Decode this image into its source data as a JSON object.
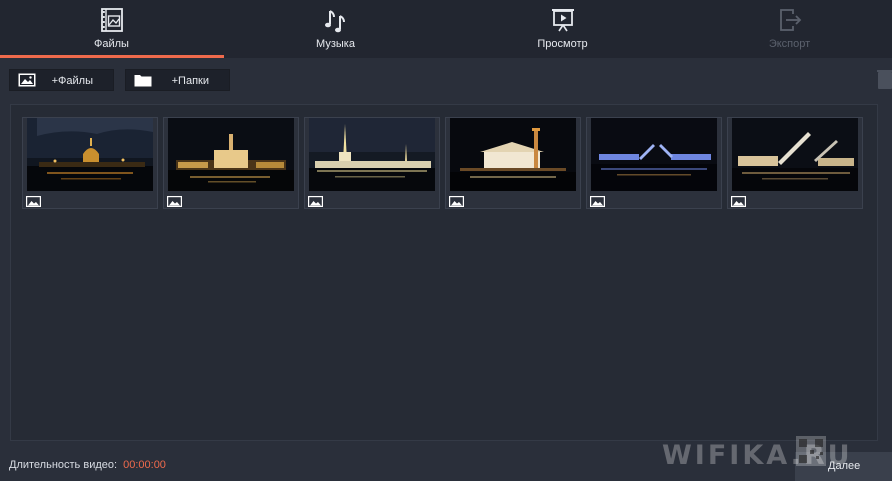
{
  "tabs": [
    {
      "label": "Файлы",
      "icon": "film-image-icon",
      "active": true
    },
    {
      "label": "Музыка",
      "icon": "music-notes-icon",
      "active": false
    },
    {
      "label": "Просмотр",
      "icon": "presentation-play-icon",
      "active": false
    },
    {
      "label": "Экспорт",
      "icon": "export-icon",
      "active": false,
      "disabled": true
    }
  ],
  "toolbar": {
    "add_files_label": "+Файлы",
    "add_folders_label": "+Папки"
  },
  "thumbnails": [
    {
      "type": "image"
    },
    {
      "type": "image"
    },
    {
      "type": "image"
    },
    {
      "type": "image"
    },
    {
      "type": "image"
    },
    {
      "type": "image"
    }
  ],
  "footer": {
    "duration_label": "Длительность видео:",
    "duration_value": "00:00:00",
    "next_label": "Далее"
  },
  "watermark": "WIFIKA.RU",
  "colors": {
    "accent": "#ef6a4c",
    "background": "#2a2f3a",
    "tabbar": "#222630"
  }
}
